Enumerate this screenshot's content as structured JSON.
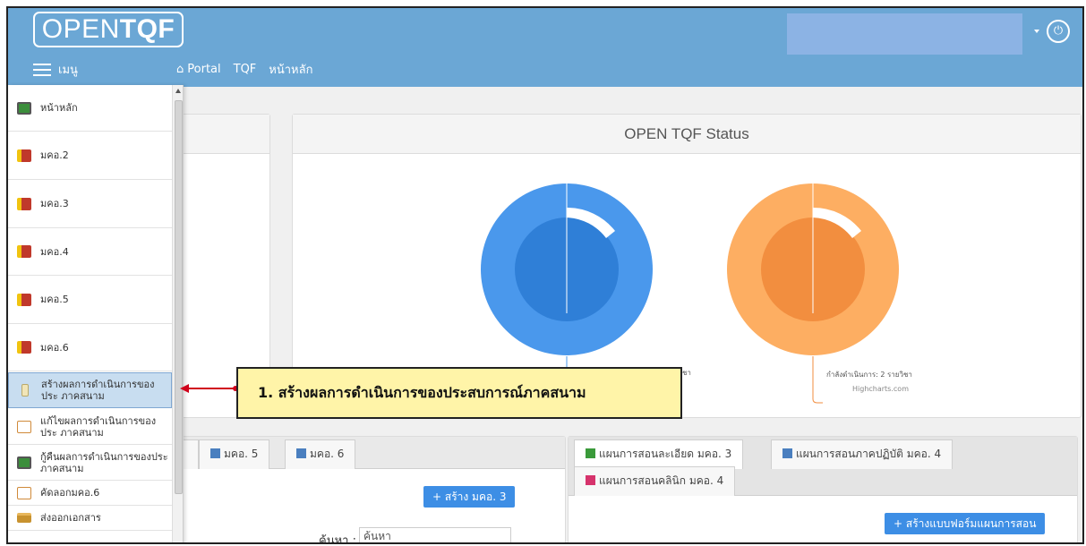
{
  "header": {
    "logo_prefix": "OPEN",
    "logo_bold": "TQF",
    "menu_label": "เมนู",
    "nav": [
      "Portal",
      "TQF",
      "หน้าหลัก"
    ],
    "power_icon": "power-icon"
  },
  "sidebar": {
    "items": [
      {
        "label": "หน้าหลัก",
        "icon": "monitor-icon"
      },
      {
        "label": "มคอ.2",
        "icon": "book-icon"
      },
      {
        "label": "มคอ.3",
        "icon": "book-icon"
      },
      {
        "label": "มคอ.4",
        "icon": "book-icon"
      },
      {
        "label": "มคอ.5",
        "icon": "book-icon"
      },
      {
        "label": "มคอ.6",
        "icon": "book-icon"
      },
      {
        "label": "สร้างผลการดำเนินการของประ ภาคสนาม",
        "icon": "document-icon"
      },
      {
        "label": "แก้ไขผลการดำเนินการของประ ภาคสนาม",
        "icon": "edit-icon"
      },
      {
        "label": "กู้คืนผลการดำเนินการของประ ภาคสนาม",
        "icon": "monitor-icon"
      },
      {
        "label": "คัดลอกมคอ.6",
        "icon": "edit-icon"
      },
      {
        "label": "ส่งออกเอกสาร",
        "icon": "folder-icon"
      }
    ]
  },
  "status_panel": {
    "title": "OPEN TQF Status",
    "left_chart_label": "ชา",
    "right_chart_label": "กำลังดำเนินการ: 2 รายวิชา",
    "credit": "Highcharts.com"
  },
  "callout": {
    "text": "1. สร้างผลการดำเนินการของประสบการณ์ภาคสนาม"
  },
  "bottom_left": {
    "tabs": [
      "มคอ. 5",
      "มคอ. 6"
    ],
    "create_button": "+ สร้าง มคอ. 3"
  },
  "bottom_right": {
    "tabs": [
      "แผนการสอนละเอียด มคอ. 3",
      "แผนการสอนภาคปฏิบัติ มคอ. 4",
      "แผนการสอนคลินิก มคอ. 4"
    ],
    "create_button": "+ สร้างแบบฟอร์มแผนการสอน"
  },
  "search": {
    "label": "ค้นหา :",
    "placeholder": "ค้นหา"
  },
  "colors": {
    "header": "#6ba7d5",
    "blue_chart_outer": "#4a98ec",
    "blue_chart_inner": "#2f7fd7",
    "orange_chart_outer": "#fdae62",
    "orange_chart_inner": "#f28e3f",
    "callout_bg": "#fff4a8",
    "arrow": "#d0021b"
  }
}
